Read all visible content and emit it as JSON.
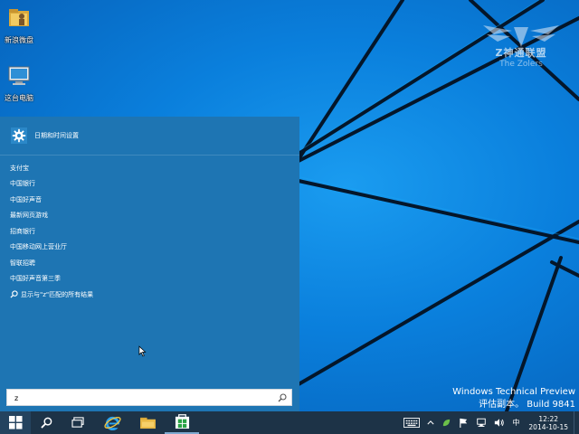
{
  "desktop": {
    "icons": [
      {
        "label": "新浪微盘",
        "icon": "folder-icon"
      },
      {
        "label": "这台电脑",
        "icon": "computer-icon"
      }
    ],
    "watermark": {
      "title": "Z神通联盟",
      "subtitle": "The Zolers"
    },
    "build_info": {
      "line1": "Windows Technical Preview",
      "line2": "评估副本。 Build 9841"
    }
  },
  "start_menu": {
    "top_result": {
      "label": "日期和时间设置",
      "icon": "gear-icon"
    },
    "results": [
      "支付宝",
      "中国银行",
      "中国好声音",
      "最新网页游戏",
      "招商银行",
      "中国移动网上营业厅",
      "智联招聘",
      "中国好声音第三季",
      "显示与\"z\"匹配的所有结果"
    ],
    "search": {
      "value": "z"
    }
  },
  "taskbar": {
    "tray": {
      "ime": "中",
      "time": "12:22",
      "date": "2014-10-15"
    }
  },
  "colors": {
    "start_menu_bg": "#1e75b3",
    "taskbar_bg": "#1d3347",
    "desktop_bg": "#0a7fdc"
  }
}
